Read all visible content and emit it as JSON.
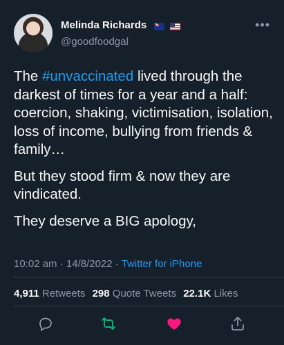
{
  "author": {
    "name": "Melinda Richards",
    "handle": "@goodfoodgal",
    "flags": [
      "australia-flag-icon",
      "usa-flag-icon"
    ]
  },
  "menu": {
    "more_label": "•••"
  },
  "tweet": {
    "para1_hashtag": "#unvaccinated",
    "para1_before": "The ",
    "para1_after": " lived through the darkest of times for a year and a half: coercion, shaking, victimisation, isolation, loss of income, bullying from friends & family…",
    "para2": "But they stood firm & now they are vindicated.",
    "para3": "They deserve a BIG apology,"
  },
  "meta": {
    "time": "10:02 am",
    "separator": " · ",
    "date": "14/8/2022",
    "source": "Twitter for iPhone"
  },
  "stats": {
    "retweets_count": "4,911",
    "retweets_label": "Retweets",
    "quotes_count": "298",
    "quotes_label": "Quote Tweets",
    "likes_count": "22.1K",
    "likes_label": "Likes"
  },
  "colors": {
    "background": "#15202b",
    "text": "#f7f9f9",
    "muted": "#8b98a5",
    "link": "#1d9bf0",
    "retweet_green": "#00ba7c",
    "like_pink": "#f91880",
    "divider": "#38444d"
  }
}
